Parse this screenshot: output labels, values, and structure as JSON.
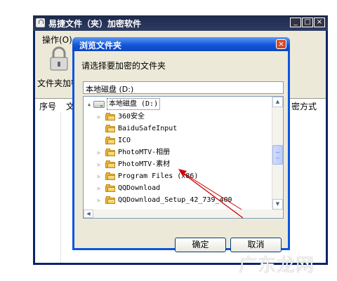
{
  "app": {
    "title": "易捷文件（夹）加密软件",
    "menu_operation": "操作(O)",
    "lock_label": "文件夹加密",
    "columns": [
      "序号",
      "文",
      "密方式"
    ]
  },
  "dialog": {
    "title": "浏览文件夹",
    "close_glyph": "×",
    "prompt": "请选择要加密的文件夹",
    "path_value": "本地磁盘 (D:)",
    "tree": {
      "drive_label": "本地磁盘 (D:)",
      "folders": [
        "360安全",
        "BaiduSafeInput",
        "ICO",
        "PhotoMTV-相册",
        "PhotoMTV-素材",
        "Program Files (x86)",
        "QQDownload",
        "QQDownload_Setup_42_739_400"
      ]
    },
    "ok_label": "确定",
    "cancel_label": "取消"
  },
  "watermark": "广东龙网",
  "colors": {
    "dialog_title": "#0c55e0",
    "app_title": "#1e2a4a",
    "folder": "#e8b43a",
    "arrow": "#cc0000"
  }
}
